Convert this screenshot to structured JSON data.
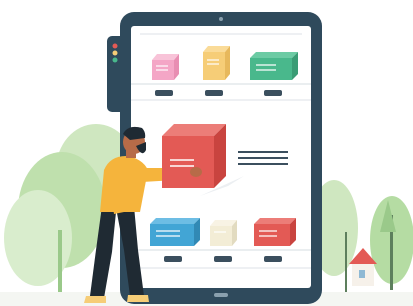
{
  "illustration": {
    "subject": "man-loading-box-into-tablet-store",
    "colors": {
      "tablet_frame": "#2f4a5c",
      "tablet_screen": "#ffffff",
      "shelf_line": "#e3e8ec",
      "box_pink": "#f4a6c6",
      "box_yellow": "#f6cd77",
      "box_green": "#49b88c",
      "box_red": "#e35a55",
      "box_blue": "#42a5d5",
      "box_cream": "#f3edd6",
      "shirt": "#f5b43c",
      "pants": "#1f2a33",
      "skin": "#b76b48",
      "foliage_light": "#cfe7c0",
      "foliage_mid": "#b5dca3",
      "foliage_dark": "#9ac98a",
      "house": "#f6f1ea",
      "roof": "#e35a55"
    },
    "icons": {
      "camera": "camera-dot-icon",
      "home": "home-indicator-icon",
      "status_lights": "traffic-light-icon",
      "description_lines": "text-lines-icon"
    }
  }
}
